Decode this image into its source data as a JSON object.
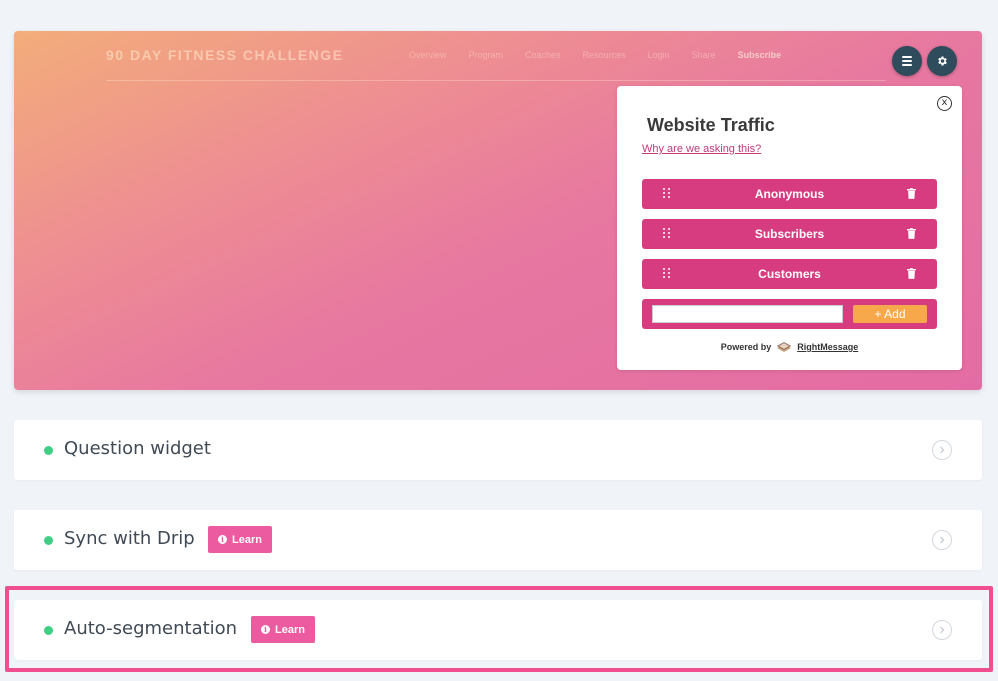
{
  "hero": {
    "site_title": "90 DAY FITNESS CHALLENGE",
    "nav_items": [
      "Overview",
      "Program",
      "Coaches",
      "Resources",
      "Login",
      "Share",
      "Subscribe"
    ],
    "menu_icon": "hamburger-icon",
    "settings_icon": "gear-icon"
  },
  "widget": {
    "close_label": "x",
    "title": "Website Traffic",
    "why_link": "Why are we asking this?",
    "options": [
      "Anonymous",
      "Subscribers",
      "Customers"
    ],
    "new_option_value": "",
    "add_button": "+ Add",
    "powered_by": "Powered by",
    "brand": "RightMessage",
    "colors": {
      "option_bg": "#d63c7f",
      "add_btn": "#f7a84b"
    }
  },
  "rows": [
    {
      "label": "Question widget",
      "learn": null
    },
    {
      "label": "Sync with Drip",
      "learn": "Learn"
    },
    {
      "label": "Auto-segmentation",
      "learn": "Learn"
    }
  ],
  "colors": {
    "status_dot": "#3ecf84",
    "learn_badge": "#ec5a9f",
    "highlight": "#ef4f8f"
  }
}
